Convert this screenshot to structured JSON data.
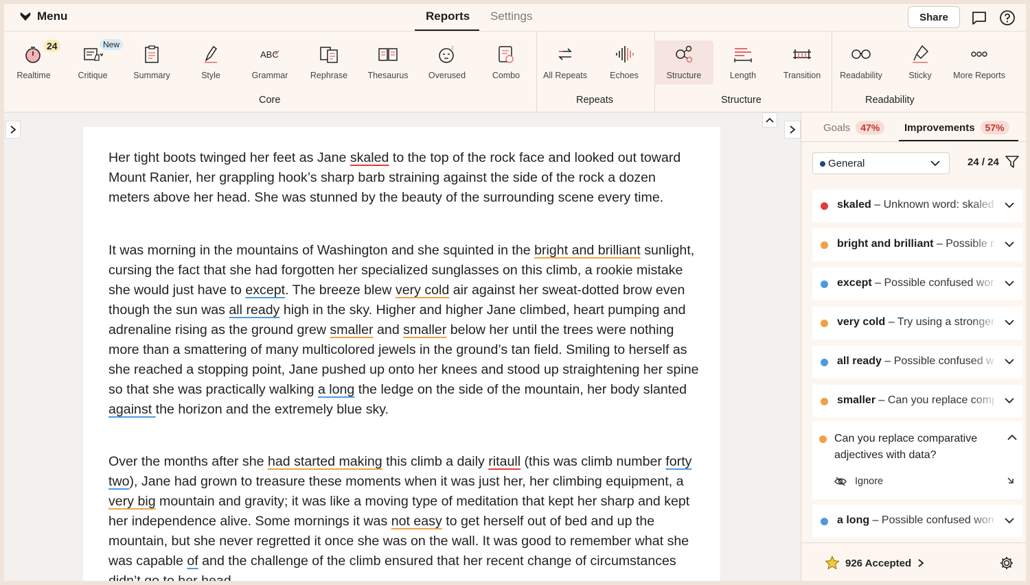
{
  "topbar": {
    "menu_label": "Menu",
    "tabs": [
      {
        "label": "Reports"
      },
      {
        "label": "Settings"
      }
    ],
    "share_label": "Share"
  },
  "ribbon": {
    "realtime_badge": "24",
    "new_badge": "New",
    "tools": [
      {
        "label": "Realtime",
        "icon": "timer-icon"
      },
      {
        "label": "Critique",
        "icon": "critique-icon"
      },
      {
        "label": "Summary",
        "icon": "clipboard-icon"
      },
      {
        "label": "Style",
        "icon": "pen-icon"
      },
      {
        "label": "Grammar",
        "icon": "abc-icon"
      },
      {
        "label": "Rephrase",
        "icon": "rephrase-icon"
      },
      {
        "label": "Thesaurus",
        "icon": "book-icon"
      },
      {
        "label": "Overused",
        "icon": "sleepy-face-icon"
      },
      {
        "label": "Combo",
        "icon": "combo-icon"
      },
      {
        "label": "All Repeats",
        "icon": "repeat-icon"
      },
      {
        "label": "Echoes",
        "icon": "echo-icon"
      },
      {
        "label": "Structure",
        "icon": "structure-icon"
      },
      {
        "label": "Length",
        "icon": "length-icon"
      },
      {
        "label": "Transition",
        "icon": "bridge-icon"
      },
      {
        "label": "Readability",
        "icon": "glasses-icon"
      },
      {
        "label": "Sticky",
        "icon": "sticky-icon"
      },
      {
        "label": "More Reports",
        "icon": "more-icon"
      }
    ],
    "groups": [
      {
        "label": "Core"
      },
      {
        "label": "Repeats"
      },
      {
        "label": "Structure"
      },
      {
        "label": "Readability"
      }
    ]
  },
  "document": {
    "p1": [
      "Her tight boots twinged her feet as Jane ",
      "skaled",
      " to the top of the rock face and looked out toward Mount Ranier, her grappling hook’s sharp barb straining against the side of the rock a dozen meters above her head. She was stunned by the beauty of the surrounding scene every time."
    ],
    "p2": [
      "It was morning in the mountains of Washington and she squinted in the ",
      "bright and brilliant",
      " sunlight, cursing the fact that she had forgotten her specialized sunglasses on this climb, a rookie mistake she would just have to ",
      "except",
      ". The breeze blew ",
      "very cold",
      " air against her sweat-dotted brow even though the sun was ",
      "all ready",
      " high in the sky. Higher and higher Jane climbed, heart pumping and adrenaline rising as the ground grew ",
      "smaller",
      " and ",
      "smaller",
      " below her until the trees were nothing more than a smattering of many multicolored jewels in the ground’s tan field. Smiling to herself as she reached a stopping point, Jane pushed up onto her knees and stood up straightening her spine so that she was practically walking ",
      "a long",
      " the ledge on the side of the mountain, her body slanted ",
      "against ",
      "the horizon and the extremely blue sky."
    ],
    "p3": [
      "Over the months after she ",
      "had started making",
      " this climb a daily ",
      "ritaull",
      " (this was climb number ",
      "forty two",
      "), Jane had grown to treasure these moments when it was just her, her climbing equipment, a ",
      "very big",
      " mountain and gravity; it was like a moving type of meditation that kept her sharp and kept her independence alive. Some mornings it was ",
      "not easy",
      " to get herself out of bed and up the mountain, but she never regretted it once she was on the wall. It was good to remember what she was capable ",
      "of",
      " and the challenge of the climb ensured that her recent change of circumstances didn’t go to her head."
    ]
  },
  "panel": {
    "goals_label": "Goals",
    "goals_pct": "47%",
    "improvements_label": "Improvements",
    "improvements_pct": "57%",
    "filter_value": "General",
    "count": "24 / 24",
    "suggestions": [
      {
        "word": "skaled",
        "desc": "Unknown word: skaled",
        "color": "#e23b3b"
      },
      {
        "word": "bright and brilliant",
        "desc": "Possible redundancy",
        "color": "#f0a146"
      },
      {
        "word": "except",
        "desc": "Possible confused word",
        "color": "#4b9be0"
      },
      {
        "word": "very cold",
        "desc": "Try using a stronger word",
        "color": "#f0a146"
      },
      {
        "word": "all ready",
        "desc": "Possible confused word",
        "color": "#4b9be0"
      },
      {
        "word": "smaller",
        "desc": "Can you replace comparative",
        "color": "#f0a146"
      },
      {
        "word": "a long",
        "desc": "Possible confused word",
        "color": "#4b9be0"
      }
    ],
    "expanded_text": "Can you replace comparative adjectives with data?",
    "ignore_label": "Ignore",
    "accepted_label": "926 Accepted"
  }
}
